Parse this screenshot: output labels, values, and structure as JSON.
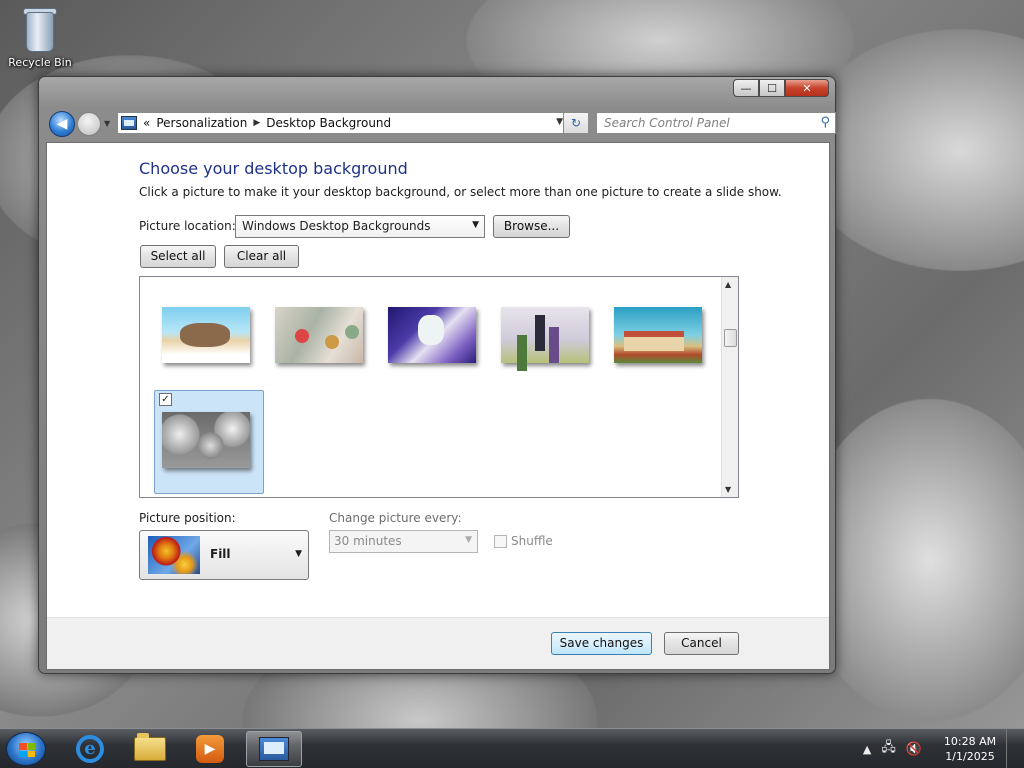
{
  "desktop": {
    "recycle_bin_label": "Recycle Bin"
  },
  "window": {
    "title_buttons": {
      "minimize": "—",
      "maximize": "☐",
      "close": "✕"
    },
    "breadcrumb": {
      "root_chevron": "«",
      "items": [
        "Personalization",
        "Desktop Background"
      ]
    },
    "search_placeholder": "Search Control Panel"
  },
  "content": {
    "title": "Choose your desktop background",
    "description": "Click a picture to make it your desktop background, or select more than one picture to create a slide show.",
    "picture_location_label": "Picture location:",
    "picture_location_value": "Windows Desktop Backgrounds",
    "browse_button": "Browse...",
    "select_all_button": "Select all",
    "clear_all_button": "Clear all",
    "gallery": {
      "thumbnails": [
        {
          "name": "wallpaper-1",
          "selected": false
        },
        {
          "name": "wallpaper-2",
          "selected": false
        },
        {
          "name": "wallpaper-3",
          "selected": false
        },
        {
          "name": "wallpaper-4",
          "selected": false
        },
        {
          "name": "wallpaper-5",
          "selected": false
        },
        {
          "name": "wallpaper-6",
          "selected": true
        }
      ],
      "check_mark": "✓"
    },
    "picture_position_label": "Picture position:",
    "picture_position_value": "Fill",
    "change_picture_label": "Change picture every:",
    "change_picture_value": "30 minutes",
    "shuffle_label": "Shuffle",
    "save_button": "Save changes",
    "cancel_button": "Cancel"
  },
  "taskbar": {
    "items": [
      "start-button",
      "internet-explorer",
      "windows-explorer",
      "windows-media-player",
      "control-panel"
    ],
    "time": "10:28 AM",
    "date": "1/1/2025"
  },
  "colors": {
    "title_blue": "#1e3287",
    "selection_blue": "#cce4f7"
  }
}
